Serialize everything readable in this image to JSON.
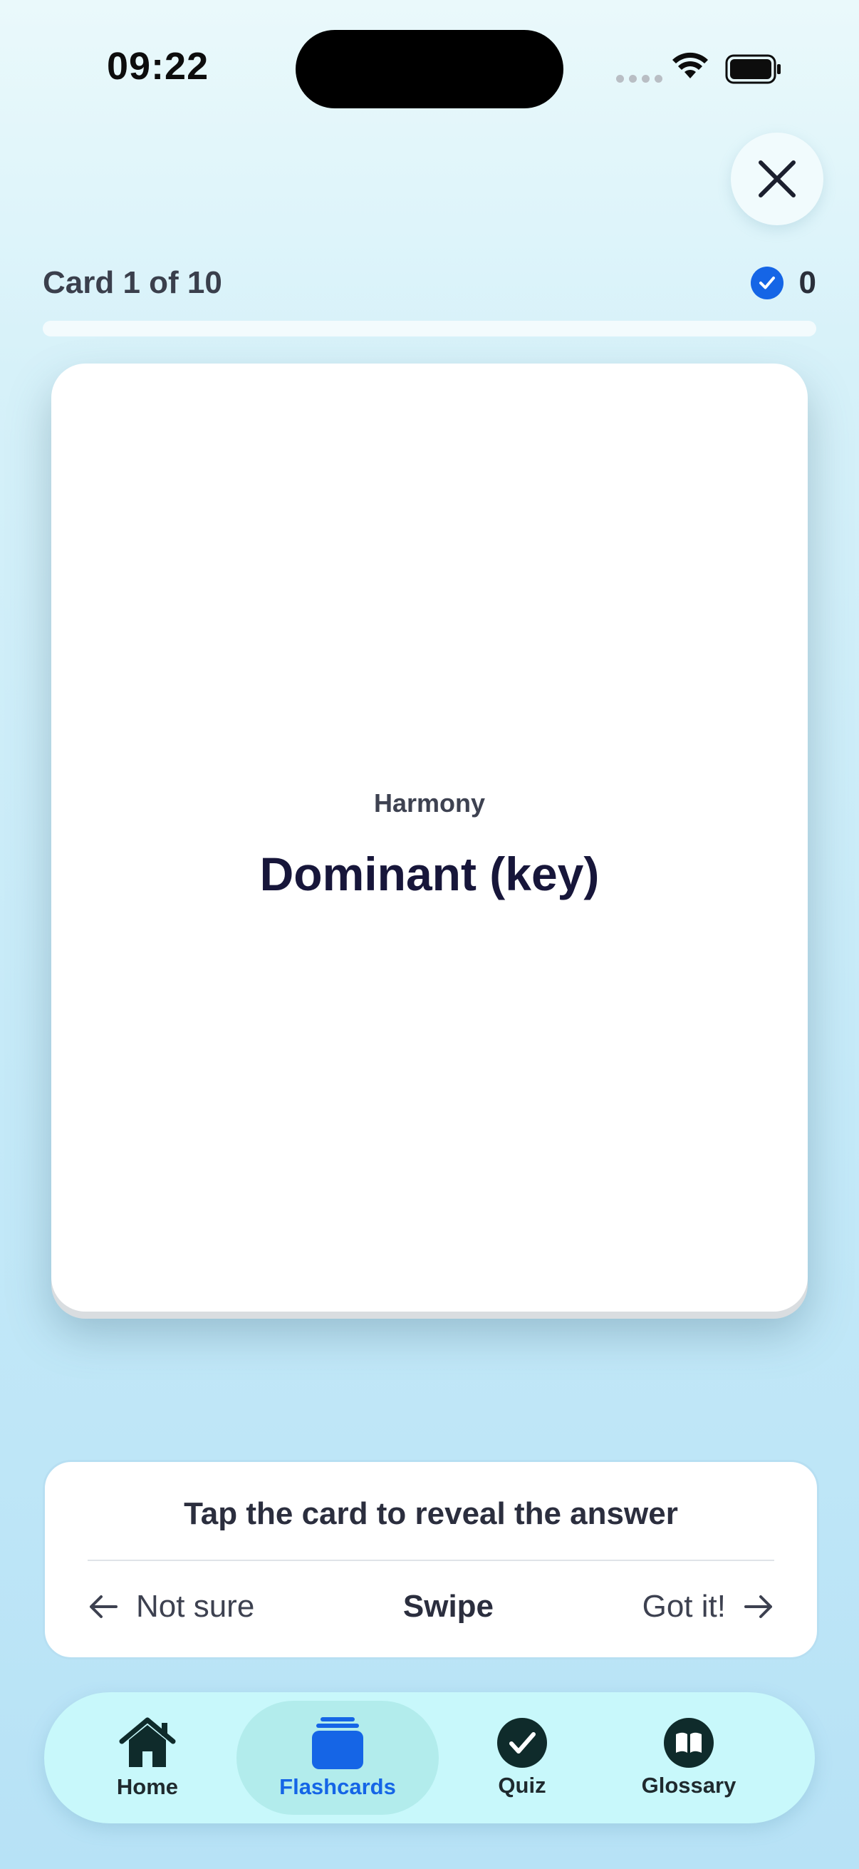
{
  "status_bar": {
    "time": "09:22"
  },
  "header": {
    "card_counter": "Card 1 of 10",
    "correct_count": "0",
    "progress_fraction": 0.0
  },
  "card": {
    "category": "Harmony",
    "term": "Dominant (key)"
  },
  "instructions": {
    "title": "Tap the card to reveal the answer",
    "left_label": "Not sure",
    "center_label": "Swipe",
    "right_label": "Got it!"
  },
  "nav": {
    "items": [
      {
        "label": "Home",
        "icon": "home-icon"
      },
      {
        "label": "Flashcards",
        "icon": "flashcards-icon",
        "active": true
      },
      {
        "label": "Quiz",
        "icon": "check-circle-icon"
      },
      {
        "label": "Glossary",
        "icon": "book-icon"
      }
    ]
  },
  "colors": {
    "accent": "#1565e6",
    "nav_bg": "#c8f8fb",
    "nav_active": "#b2ecec",
    "icon_dark": "#0f2b2b"
  }
}
